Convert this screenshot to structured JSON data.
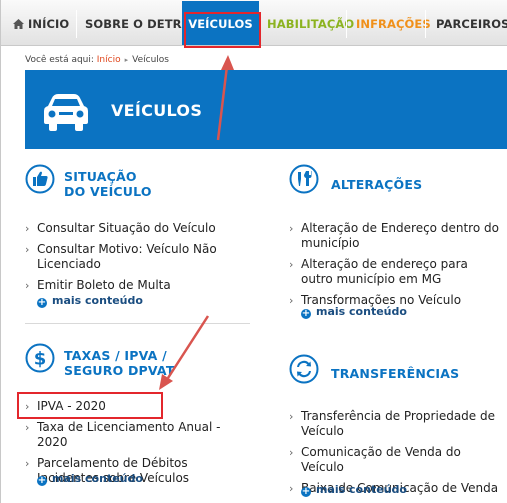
{
  "nav": {
    "items": [
      {
        "label": "INÍCIO",
        "color": "#333333"
      },
      {
        "label": "SOBRE O DETRAN",
        "color": "#333333"
      },
      {
        "label": "VEÍCULOS",
        "color": "#ffffff",
        "active": true
      },
      {
        "label": "HABILITAÇÃO",
        "color": "#8cb320"
      },
      {
        "label": "INFRAÇÕES",
        "color": "#f0901a"
      },
      {
        "label": "PARCEIROS CR",
        "color": "#333333"
      }
    ]
  },
  "breadcrumb": {
    "prefix": "Você está aqui:",
    "home": "Início",
    "separator": "▸",
    "current": "Veículos"
  },
  "banner": {
    "title": "VEÍCULOS",
    "icon": "car-icon",
    "bg_color": "#0b73c2"
  },
  "sections": {
    "situacao": {
      "title_line1": "SITUAÇÃO",
      "title_line2": "DO VEÍCULO",
      "icon": "thumbs-up-car-icon",
      "items": [
        "Consultar Situação do Veículo",
        "Consultar Motivo: Veículo Não Licenciado",
        "Emitir Boleto de Multa"
      ],
      "more": "mais conteúdo"
    },
    "alteracoes": {
      "title": "ALTERAÇÕES",
      "icon": "tools-icon",
      "items": [
        "Alteração de Endereço dentro do município",
        "Alteração de endereço para outro município em MG",
        "Transformações no Veículo"
      ],
      "more": "mais conteúdo"
    },
    "taxas": {
      "title_line1": "TAXAS / IPVA /",
      "title_line2": "SEGURO DPVAT",
      "icon": "dollar-icon",
      "items": [
        "IPVA - 2020",
        "Taxa de Licenciamento Anual - 2020",
        "Parcelamento de Débitos Incidentes sobre Veículos"
      ],
      "more": "mais conteúdo"
    },
    "transferencias": {
      "title": "TRANSFERÊNCIAS",
      "icon": "transfer-car-icon",
      "items": [
        "Transferência de Propriedade de Veículo",
        "Comunicação de Venda do Veículo",
        "Baixa de Comunicação de Venda"
      ],
      "more": "mais conteúdo"
    }
  },
  "chevron": "›",
  "plus": "+",
  "colors": {
    "accent": "#0b73c2",
    "annotation": "#e3262c",
    "link": "#e0471d"
  }
}
